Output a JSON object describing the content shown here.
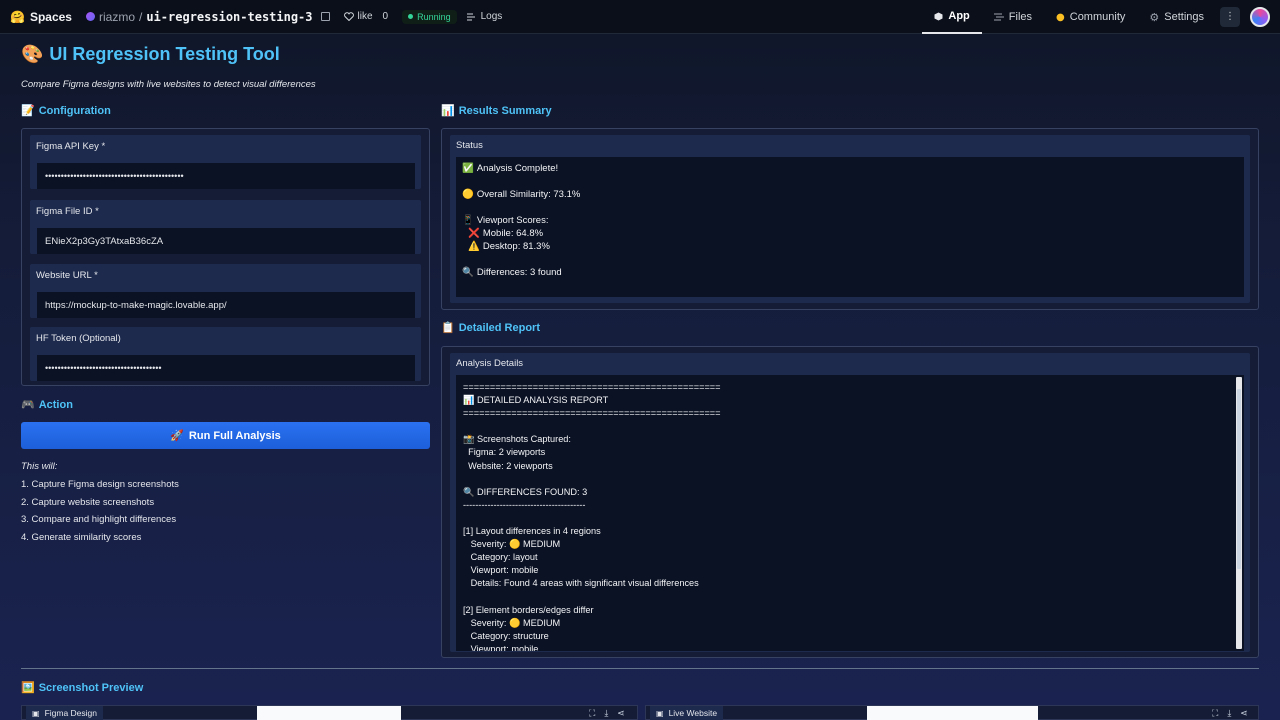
{
  "topbar": {
    "brand": "Spaces",
    "brand_emoji": "🤗",
    "owner": "riazmo",
    "sep": "/",
    "repo": "ui-regression-testing-3",
    "like_label": "like",
    "like_count": "0",
    "status": "Running",
    "logs": "Logs",
    "nav": {
      "app": "App",
      "files": "Files",
      "community": "Community",
      "settings": "Settings"
    }
  },
  "header": {
    "title_emoji": "🎨",
    "title": "UI Regression Testing Tool",
    "subtitle": "Compare Figma designs with live websites to detect visual differences"
  },
  "config": {
    "heading_emoji": "📝",
    "heading": "Configuration",
    "fields": [
      {
        "label": "Figma API Key *",
        "value": "••••••••••••••••••••••••••••••••••••••••••••"
      },
      {
        "label": "Figma File ID *",
        "value": "ENieX2p3Gy3TAtxaB36cZA"
      },
      {
        "label": "Website URL *",
        "value": "https://mockup-to-make-magic.lovable.app/"
      },
      {
        "label": "HF Token (Optional)",
        "value": "•••••••••••••••••••••••••••••••••••••"
      }
    ]
  },
  "action": {
    "heading_emoji": "🎮",
    "heading": "Action",
    "button_emoji": "🚀",
    "button": "Run Full Analysis",
    "will": "This will:",
    "steps": [
      "1. Capture Figma design screenshots",
      "2. Capture website screenshots",
      "3. Compare and highlight differences",
      "4. Generate similarity scores"
    ]
  },
  "results": {
    "heading_emoji": "📊",
    "heading": "Results Summary",
    "status_label": "Status",
    "lines": [
      {
        "emoji": "✅",
        "text": "Analysis Complete!"
      },
      {
        "emoji": "🟡",
        "text": "Overall Similarity: 73.1%"
      },
      {
        "emoji": "📱",
        "text": "Viewport Scores:"
      },
      {
        "emoji": "❌",
        "text": "Mobile: 64.8%"
      },
      {
        "emoji": "⚠️",
        "text": "Desktop: 81.3%"
      },
      {
        "emoji": "🔍",
        "text": "Differences: 3 found"
      }
    ]
  },
  "report": {
    "heading_emoji": "📋",
    "heading": "Detailed Report",
    "label": "Analysis Details",
    "text": "================================================\n📊 DETAILED ANALYSIS REPORT\n================================================\n\n📸 Screenshots Captured:\n  Figma: 2 viewports\n  Website: 2 viewports\n\n🔍 DIFFERENCES FOUND: 3\n----------------------------------------\n\n[1] Layout differences in 4 regions\n   Severity: 🟡 MEDIUM\n   Category: layout\n   Viewport: mobile\n   Details: Found 4 areas with significant visual differences\n\n[2] Element borders/edges differ\n   Severity: 🟡 MEDIUM\n   Category: structure\n   Viewport: mobile"
  },
  "preview": {
    "heading_emoji": "🖼️",
    "heading": "Screenshot Preview",
    "figma_tab": "Figma Design",
    "website_tab": "Live Website"
  }
}
